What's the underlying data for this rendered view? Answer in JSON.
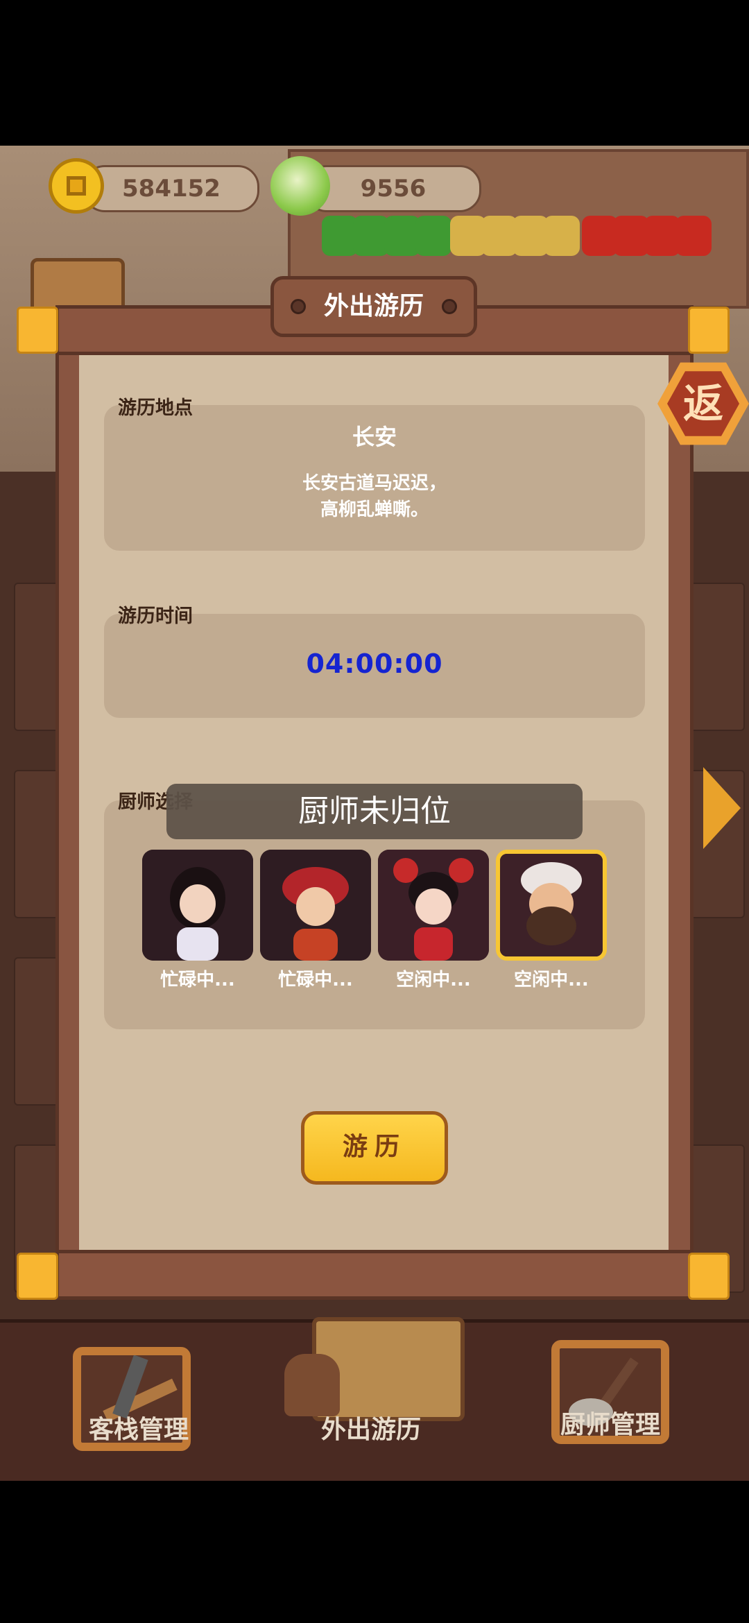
{
  "currency": {
    "coins": "584152",
    "vegetables": "9556"
  },
  "modal": {
    "title": "外出游历",
    "return_label": "返",
    "location": {
      "label": "游历地点",
      "name": "长安",
      "desc_line1": "长安古道马迟迟，",
      "desc_line2": "高柳乱蝉嘶。"
    },
    "time": {
      "label": "游历时间",
      "value": "04:00:00"
    },
    "chefs": {
      "label": "厨师选择",
      "items": [
        {
          "status": "忙碌中..."
        },
        {
          "status": "忙碌中..."
        },
        {
          "status": "空闲中..."
        },
        {
          "status": "空闲中..."
        }
      ]
    },
    "toast": "厨师未归位",
    "go_button": "游历"
  },
  "bottom_nav": {
    "items": [
      {
        "label": "客栈管理"
      },
      {
        "label": "外出游历"
      },
      {
        "label": "厨师管理"
      }
    ]
  },
  "colors": {
    "accent": "#f8b631",
    "timer": "#1524d1",
    "frame": "#895541",
    "paper": "#d2bea3"
  }
}
